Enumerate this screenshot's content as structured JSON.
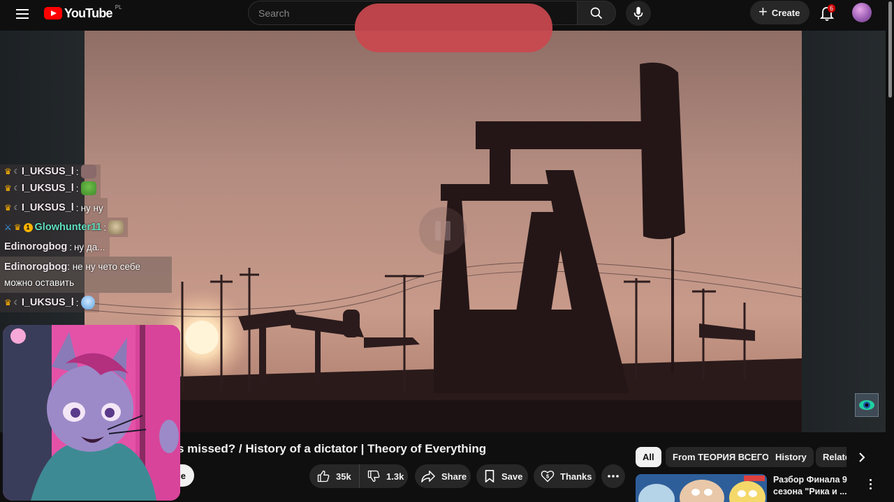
{
  "header": {
    "logo_text": "YouTube",
    "region": "PL",
    "search_placeholder": "Search",
    "create_label": "Create",
    "notifications_count": "6"
  },
  "chat": {
    "messages": [
      {
        "user": "I_UKSUS_l",
        "badges": [
          "crown",
          "moon"
        ],
        "text": "",
        "emote": "emote-face"
      },
      {
        "user": "I_UKSUS_l",
        "badges": [
          "crown",
          "moon"
        ],
        "text": "",
        "emote": "pepe-emote"
      },
      {
        "user": "I_UKSUS_l",
        "badges": [
          "crown",
          "moon"
        ],
        "text": "ну ну"
      },
      {
        "user": "Glowhunter11",
        "badges": [
          "sword",
          "crown",
          "coin"
        ],
        "text": "",
        "emote": "dog-emote"
      },
      {
        "user": "Edinorogbog",
        "badges": [],
        "text": "ну да..."
      },
      {
        "user": "Edinorogbog",
        "badges": [],
        "text": "не ну чето себе можно оставить"
      },
      {
        "user": "I_UKSUS_l",
        "badges": [
          "crown",
          "moon"
        ],
        "text": "",
        "emote": "cry-emote"
      }
    ],
    "coin_glyph": "1"
  },
  "video": {
    "title": "s missed? / History of a dictator | Theory of Everything",
    "subscribe_partial": "e",
    "likes": "35k",
    "dislikes": "1.3k",
    "share_label": "Share",
    "save_label": "Save",
    "thanks_label": "Thanks"
  },
  "chips": {
    "items": [
      "All",
      "From ТЕОРИЯ ВСЕГО",
      "History",
      "Relate"
    ],
    "active": "All"
  },
  "recommendation": {
    "title": "Разбор Финала 9 сезона \"Рика и ..."
  },
  "colors": {
    "accent_red": "#ff0000",
    "background": "#0f0f0f",
    "redaction": "#c9484f"
  }
}
